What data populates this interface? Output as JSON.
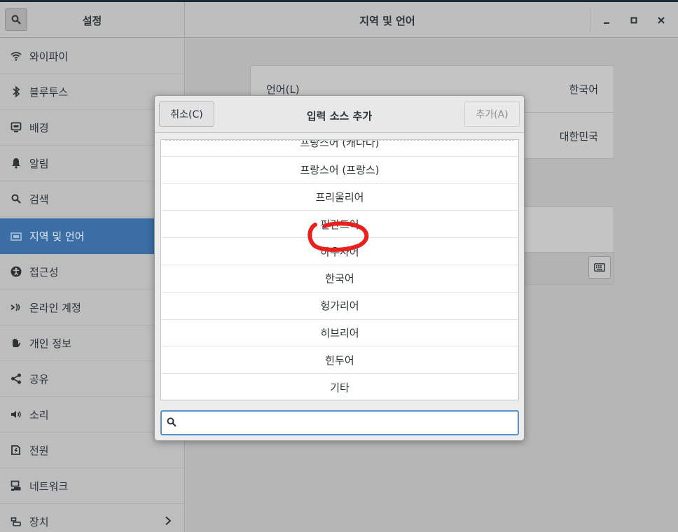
{
  "headerbar": {
    "sidebar_title": "설정",
    "title": "지역 및 언어",
    "minimize_label": "_",
    "maximize_label": "□",
    "close_label": "×"
  },
  "sidebar": {
    "items": [
      {
        "label": "와이파이",
        "icon": "wifi-icon"
      },
      {
        "label": "블루투스",
        "icon": "bluetooth-icon"
      },
      {
        "label": "배경",
        "icon": "background-icon"
      },
      {
        "label": "알림",
        "icon": "bell-icon"
      },
      {
        "label": "검색",
        "icon": "search-icon"
      },
      {
        "label": "지역 및 언어",
        "icon": "flag-icon",
        "active": true
      },
      {
        "label": "접근성",
        "icon": "accessibility-icon"
      },
      {
        "label": "온라인 계정",
        "icon": "online-accounts-icon"
      },
      {
        "label": "개인 정보",
        "icon": "hand-icon"
      },
      {
        "label": "공유",
        "icon": "share-icon"
      },
      {
        "label": "소리",
        "icon": "speaker-icon"
      },
      {
        "label": "전원",
        "icon": "power-icon"
      },
      {
        "label": "네트워크",
        "icon": "network-icon"
      },
      {
        "label": "장치",
        "icon": "devices-icon"
      }
    ]
  },
  "main": {
    "language_label": "언어(L)",
    "language_value": "한국어",
    "formats_value": "대한민국"
  },
  "dialog": {
    "title": "입력 소스 추가",
    "cancel_label": "취소(C)",
    "add_label": "추가(A)",
    "search_placeholder": "",
    "items": [
      "프랑스어 (캐나다)",
      "프랑스어 (프랑스)",
      "프리울리어",
      "핀란드어",
      "하우사어",
      "한국어",
      "헝가리어",
      "히브리어",
      "힌두어",
      "기타"
    ],
    "highlighted_item": "한국어"
  },
  "colors": {
    "sidebar_active": "#3a6ea5",
    "annotation": "#e8211f",
    "focus": "#5c8fcf"
  }
}
